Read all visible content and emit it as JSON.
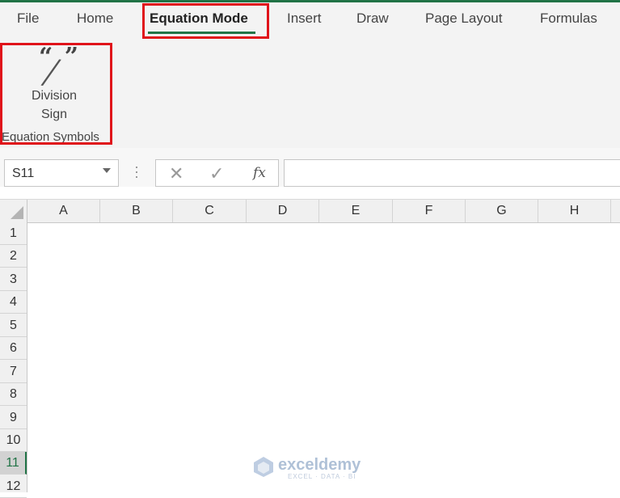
{
  "ribbon_tabs": [
    {
      "label": "File"
    },
    {
      "label": "Home"
    },
    {
      "label": "Equation Mode",
      "active": true
    },
    {
      "label": "Insert"
    },
    {
      "label": "Draw"
    },
    {
      "label": "Page Layout"
    },
    {
      "label": "Formulas"
    }
  ],
  "ribbon": {
    "button_label": "Division\nSign",
    "group_label": "Equation Symbols",
    "icon": "quote-slash-icon"
  },
  "formula_bar": {
    "name_box": "S11",
    "cancel_glyph": "✕",
    "enter_glyph": "✓",
    "fx_label": "fx",
    "formula_value": ""
  },
  "columns": [
    "A",
    "B",
    "C",
    "D",
    "E",
    "F",
    "G",
    "H"
  ],
  "rows": [
    "1",
    "2",
    "3",
    "4",
    "5",
    "6",
    "7",
    "8",
    "9",
    "10",
    "11",
    "12"
  ],
  "selected_row": "11",
  "watermark": {
    "name": "exceldemy",
    "tagline": "EXCEL · DATA · BI"
  },
  "colors": {
    "accent": "#217346",
    "highlight": "#e0131a"
  }
}
